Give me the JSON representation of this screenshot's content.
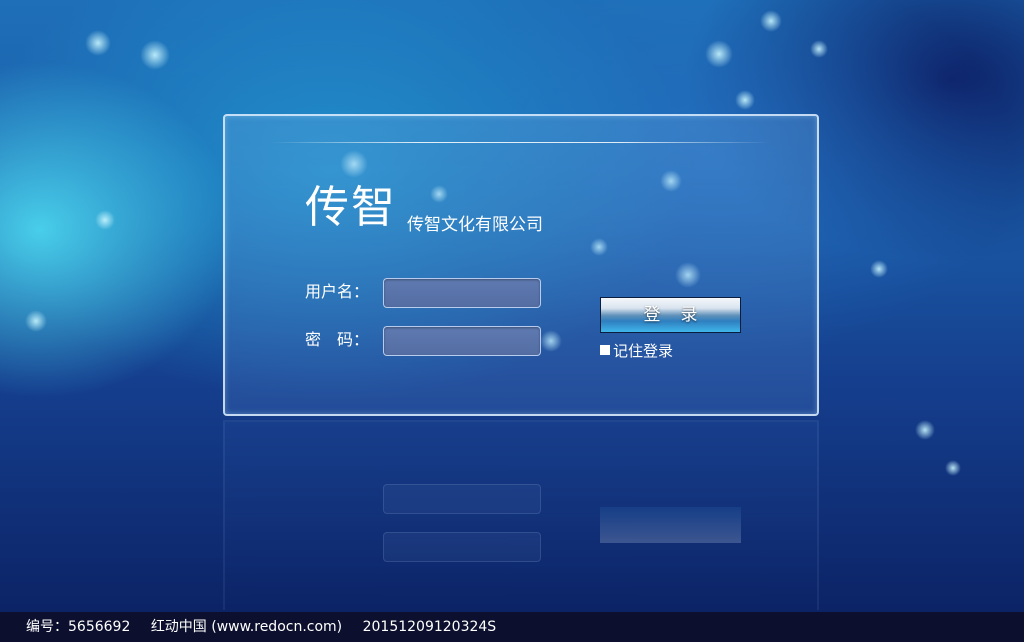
{
  "login": {
    "brand": "传智",
    "company": "传智文化有限公司",
    "username_label": "用户名：",
    "password_label": "密　码：",
    "username_value": "",
    "password_value": "",
    "login_button": "登录",
    "remember_label": "记住登录",
    "remember_checked": false
  },
  "watermark": {
    "id_text": "编号：5656692",
    "site_text": "红动中国 (www.redocn.com)",
    "timestamp": "20151209120324S"
  },
  "colors": {
    "panel_border": "#e1f0ff",
    "input_fill": "#5a74aa",
    "button_top": "#f4f7fb",
    "button_bottom": "#3fb6ea",
    "footer_bg": "#0c0f2e"
  }
}
